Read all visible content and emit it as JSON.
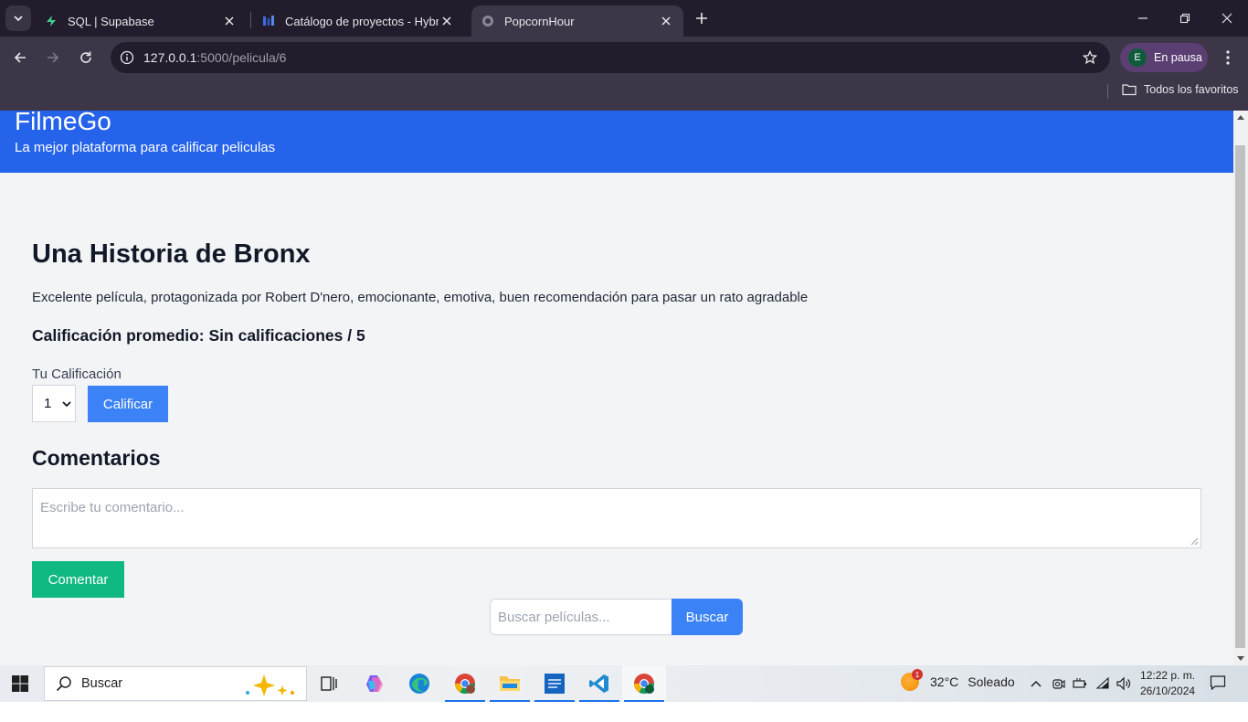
{
  "browser": {
    "tabs": [
      {
        "title": "SQL | Supabase",
        "active": false
      },
      {
        "title": "Catálogo de proyectos - Hybrid",
        "active": false
      },
      {
        "title": "PopcornHour",
        "active": true
      }
    ],
    "url_host": "127.0.0.1",
    "url_path": ":5000/pelicula/6",
    "profile_initial": "E",
    "profile_label": "En pausa",
    "bookmarks_all": "Todos los favoritos"
  },
  "site": {
    "brand": "FilmeGo",
    "tagline": "La mejor plataforma para calificar peliculas",
    "colors": {
      "header": "#2563eb",
      "primary": "#3b82f6",
      "success": "#10b981"
    }
  },
  "movie": {
    "title": "Una Historia de Bronx",
    "description": "Excelente película, protagonizada por Robert D'nero, emocionante, emotiva, buen recomendación para pasar un rato agradable",
    "average": "Calificación promedio: Sin calificaciones / 5"
  },
  "rating": {
    "label": "Tu Calificación",
    "selected": "1",
    "button": "Calificar"
  },
  "comments": {
    "title": "Comentarios",
    "placeholder": "Escribe tu comentario...",
    "button": "Comentar"
  },
  "search": {
    "placeholder": "Buscar películas...",
    "button": "Buscar"
  },
  "taskbar": {
    "search_label": "Buscar",
    "weather_temp": "32°C",
    "weather_desc": "Soleado",
    "weather_badge": "1",
    "time": "12:22 p. m.",
    "date": "26/10/2024"
  }
}
